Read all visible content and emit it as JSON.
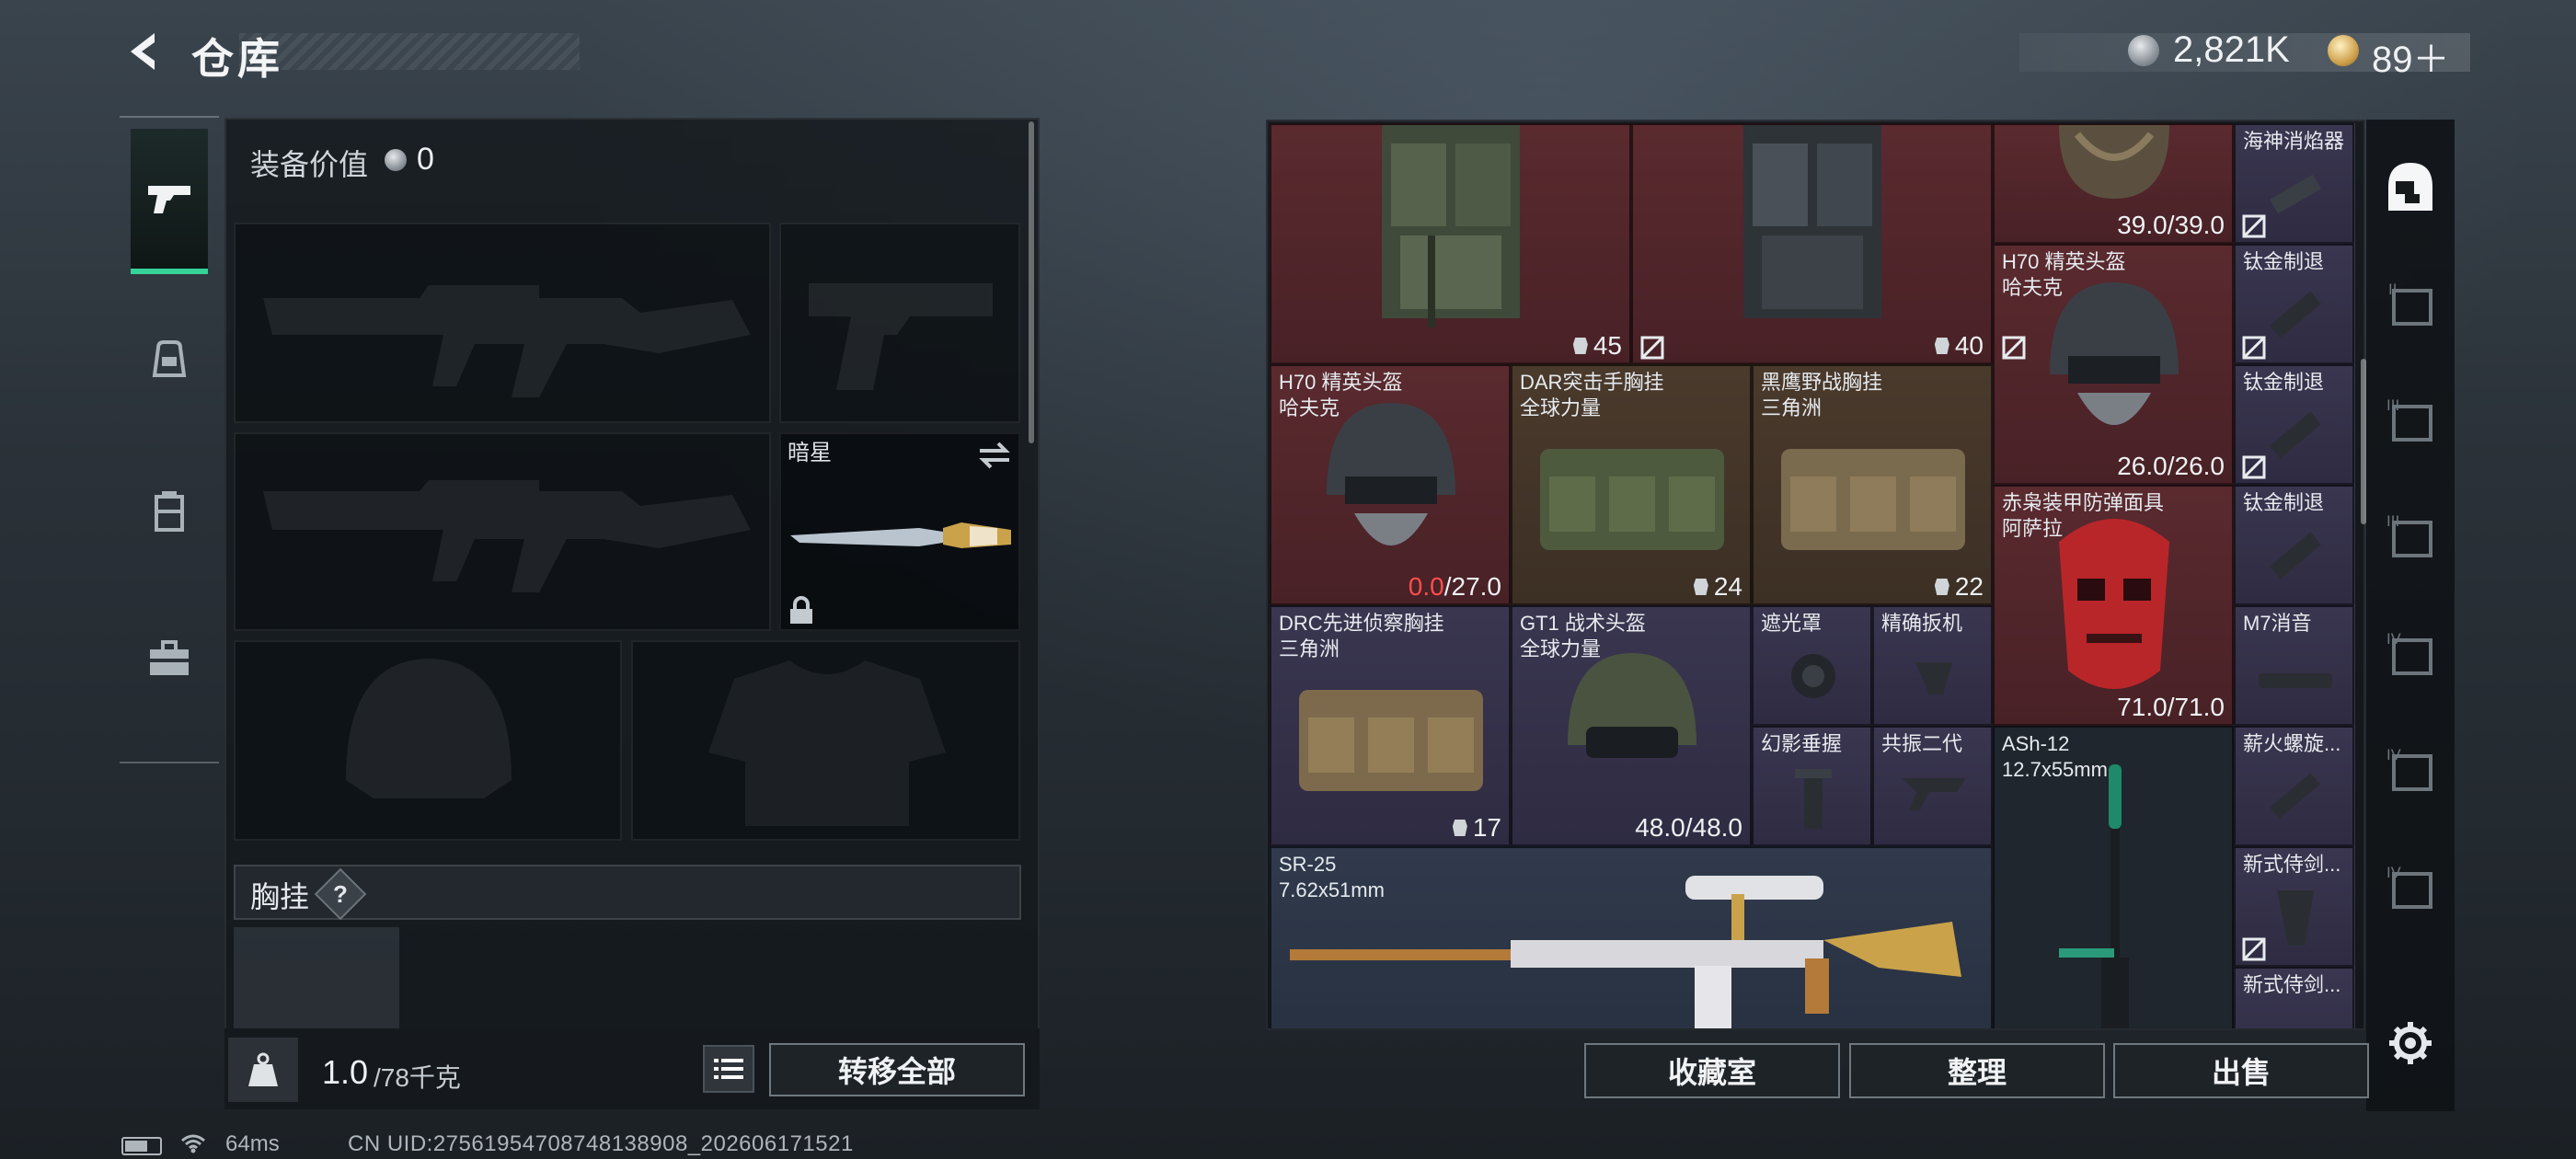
{
  "header": {
    "title": "仓库",
    "silver_amount": "2,821K",
    "gold_amount": "89＋"
  },
  "left_tabs": [
    "weapons-icon",
    "backpack-icon",
    "chest-rig-icon",
    "toolbox-icon"
  ],
  "loadout": {
    "equip_value_label": "装备价值",
    "equip_value": "0",
    "melee_name": "暗星",
    "chest_rig_label": "胸挂",
    "chest_rig_help": "?",
    "weight_value": "1.0",
    "weight_max": "/78千克",
    "transfer_all": "转移全部"
  },
  "status": {
    "ping": "64ms",
    "uid": "CN UID:27561954708748138908_202606171521"
  },
  "stash": {
    "items": [
      {
        "name": "",
        "count": "45",
        "rarity": "red"
      },
      {
        "name": "",
        "count": "40",
        "rarity": "red"
      },
      {
        "name": "",
        "durability": "39.0/39.0",
        "rarity": "red"
      },
      {
        "name": "海神消焰器",
        "rarity": "purple"
      },
      {
        "name": "H70 精英头盔\n哈夫克",
        "durability": "26.0/26.0",
        "rarity": "red"
      },
      {
        "name": "钛金制退",
        "rarity": "purple"
      },
      {
        "name": "钛金制退",
        "rarity": "purple"
      },
      {
        "name": "钛金制退",
        "rarity": "purple"
      },
      {
        "name": "H70 精英头盔\n哈夫克",
        "durability_low": "0.0",
        "durability_max": "/27.0",
        "rarity": "red"
      },
      {
        "name": "DAR突击手胸挂\n全球力量",
        "count": "24",
        "rarity": "gold"
      },
      {
        "name": "黑鹰野战胸挂\n三角洲",
        "count": "22",
        "rarity": "gold"
      },
      {
        "name": "赤枭装甲防弹面具\n阿萨拉",
        "durability": "71.0/71.0",
        "rarity": "red"
      },
      {
        "name": "M7消音",
        "rarity": "purple"
      },
      {
        "name": "DRC先进侦察胸挂\n三角洲",
        "count": "17",
        "rarity": "purple"
      },
      {
        "name": "GT1 战术头盔\n全球力量",
        "durability": "48.0/48.0",
        "rarity": "purple"
      },
      {
        "name": "遮光罩",
        "rarity": "purple"
      },
      {
        "name": "精确扳机",
        "rarity": "purple"
      },
      {
        "name": "幻影垂握",
        "rarity": "purple"
      },
      {
        "name": "共振二代",
        "rarity": "purple"
      },
      {
        "name": "ASh-12\n12.7x55mm",
        "rarity": "dark"
      },
      {
        "name": "薪火螺旋...",
        "rarity": "purple"
      },
      {
        "name": "SR-25\n7.62x51mm",
        "rarity": "blue"
      },
      {
        "name": "新式侍剑...",
        "rarity": "purple"
      },
      {
        "name": "新式侍剑...",
        "rarity": "purple"
      }
    ]
  },
  "right_tabs": [
    "stash-home-icon",
    "stash-tab-ii-icon",
    "stash-tab-iii-icon",
    "stash-tab-iii-b-icon",
    "stash-tab-iv-icon",
    "stash-tab-iv-b-icon",
    "stash-tab-iv-c-icon",
    "settings-icon"
  ],
  "bottom_buttons": {
    "collection": "收藏室",
    "sort": "整理",
    "sell": "出售"
  },
  "colors": {
    "accent_green": "#35d39a",
    "rarity_red": "#5a2a2f",
    "rarity_gold": "#4a3a2c",
    "rarity_purple": "#3a3650",
    "durability_low": "#ff4d4d"
  }
}
